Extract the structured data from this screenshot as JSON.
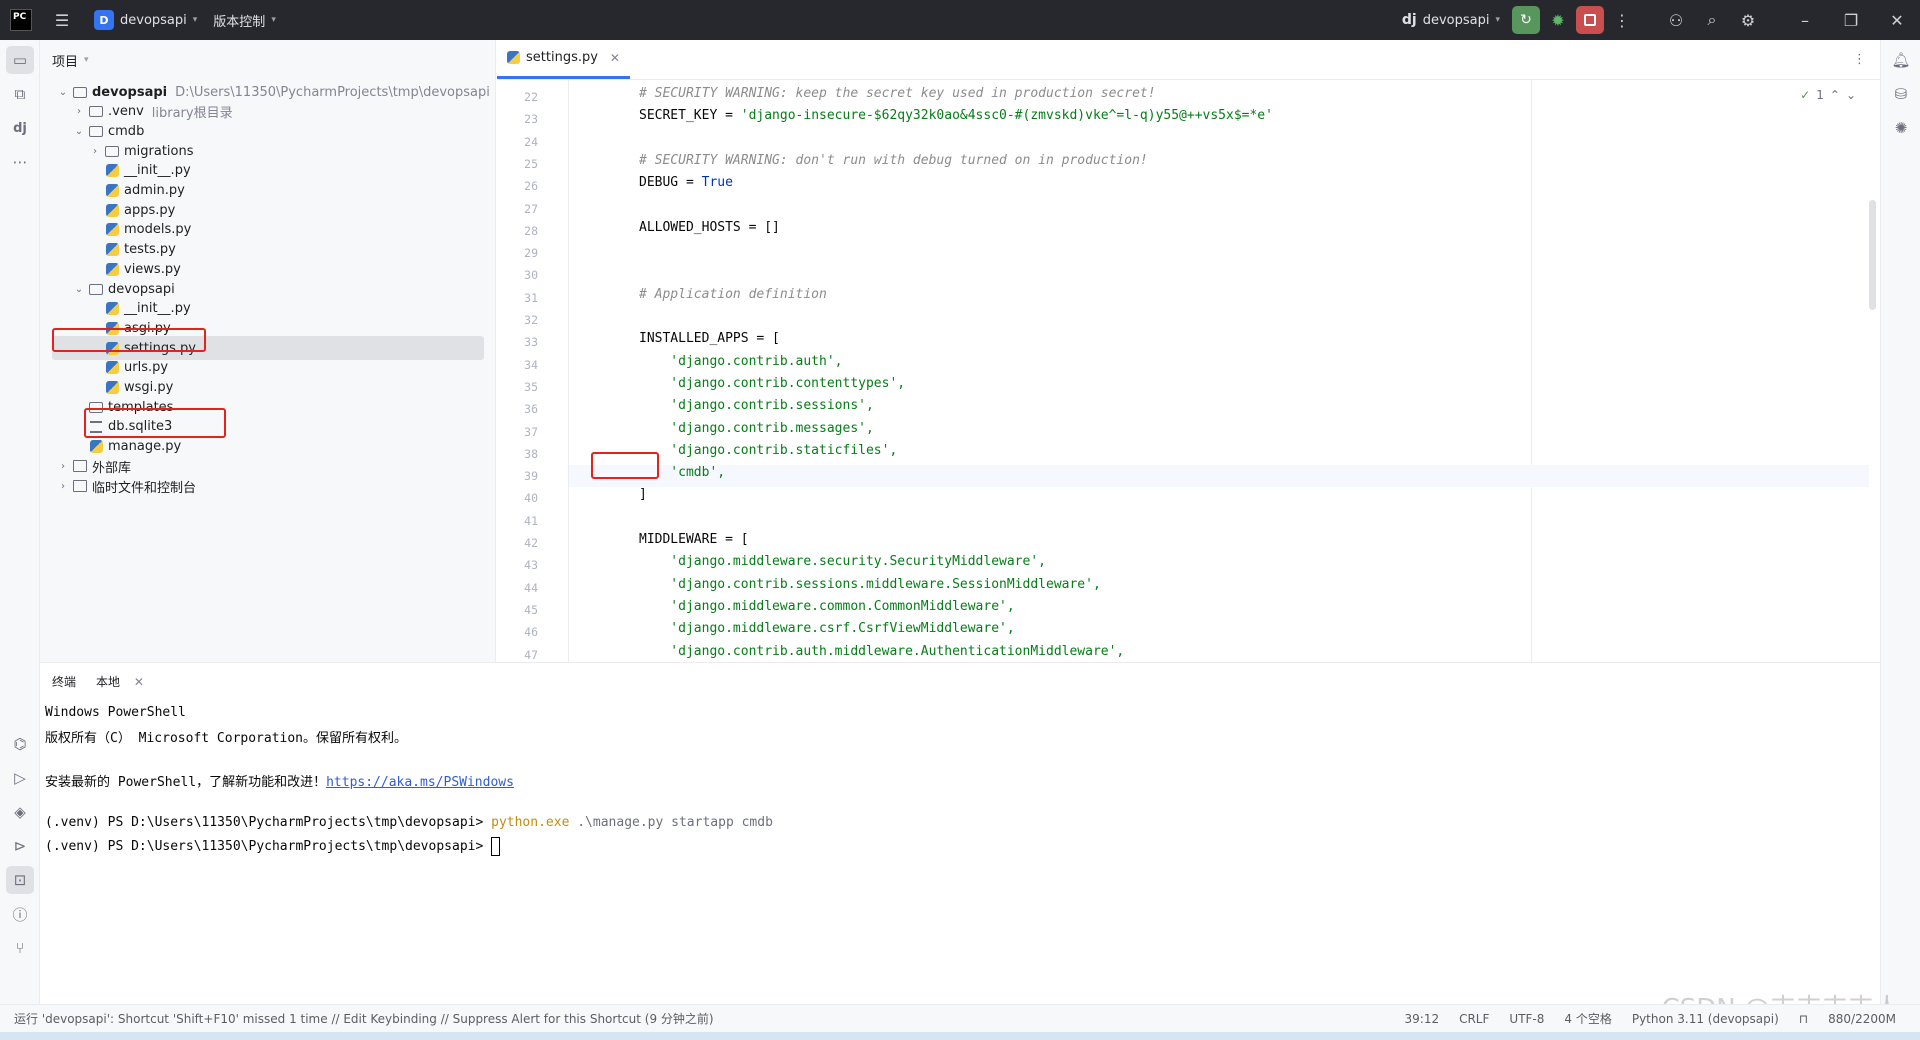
{
  "titlebar": {
    "app_logo": "PC",
    "project_badge": "D",
    "project_name": "devopsapi",
    "vcs_label": "版本控制",
    "run_config": "devopsapi",
    "icons": [
      "hamburger-icon",
      "run-icon",
      "debug-icon",
      "stop-icon",
      "more-icon",
      "add-user-icon",
      "search-icon",
      "gear-icon",
      "minimize-icon",
      "restore-icon",
      "close-icon"
    ]
  },
  "project_panel": {
    "title": "项目",
    "tree": [
      {
        "label": "devopsapi",
        "hint": "D:\\Users\\11350\\PycharmProjects\\tmp\\devopsapi",
        "type": "folder",
        "arrow": "⌄",
        "bold": true
      },
      {
        "label": ".venv",
        "hint": "library根目录",
        "type": "folder",
        "arrow": "›"
      },
      {
        "label": "cmdb",
        "hint": "",
        "type": "folder",
        "arrow": "⌄"
      },
      {
        "label": "migrations",
        "hint": "",
        "type": "folder",
        "arrow": "›"
      },
      {
        "label": "__init__.py",
        "hint": "",
        "type": "py",
        "arrow": ""
      },
      {
        "label": "admin.py",
        "hint": "",
        "type": "py",
        "arrow": ""
      },
      {
        "label": "apps.py",
        "hint": "",
        "type": "py",
        "arrow": ""
      },
      {
        "label": "models.py",
        "hint": "",
        "type": "py",
        "arrow": ""
      },
      {
        "label": "tests.py",
        "hint": "",
        "type": "py",
        "arrow": ""
      },
      {
        "label": "views.py",
        "hint": "",
        "type": "py",
        "arrow": ""
      },
      {
        "label": "devopsapi",
        "hint": "",
        "type": "folder",
        "arrow": "⌄"
      },
      {
        "label": "__init__.py",
        "hint": "",
        "type": "py",
        "arrow": ""
      },
      {
        "label": "asgi.py",
        "hint": "",
        "type": "py",
        "arrow": ""
      },
      {
        "label": "settings.py",
        "hint": "",
        "type": "py",
        "arrow": ""
      },
      {
        "label": "urls.py",
        "hint": "",
        "type": "py",
        "arrow": ""
      },
      {
        "label": "wsgi.py",
        "hint": "",
        "type": "py",
        "arrow": ""
      },
      {
        "label": "templates",
        "hint": "",
        "type": "folder",
        "arrow": ""
      },
      {
        "label": "db.sqlite3",
        "hint": "",
        "type": "db",
        "arrow": ""
      },
      {
        "label": "manage.py",
        "hint": "",
        "type": "py",
        "arrow": ""
      },
      {
        "label": "外部库",
        "hint": "",
        "type": "lib",
        "arrow": "›"
      },
      {
        "label": "临时文件和控制台",
        "hint": "",
        "type": "lib",
        "arrow": "›"
      }
    ]
  },
  "editor": {
    "tab_label": "settings.py",
    "inspection_count": "1",
    "lines": [
      {
        "n": "22",
        "t": "# SECURITY WARNING: keep the secret key used in production secret!",
        "k": "cm"
      },
      {
        "n": "23",
        "t": "SECRET_KEY = 'django-insecure-$62qy32k0ao&4ssc0-#(zmvskd)vke^=l-q)y55@++vs5x$=*e'",
        "k": "secret"
      },
      {
        "n": "24",
        "t": "",
        "k": ""
      },
      {
        "n": "25",
        "t": "# SECURITY WARNING: don't run with debug turned on in production!",
        "k": "cm"
      },
      {
        "n": "26",
        "t": "DEBUG = True",
        "k": "debug"
      },
      {
        "n": "27",
        "t": "",
        "k": ""
      },
      {
        "n": "28",
        "t": "ALLOWED_HOSTS = []",
        "k": ""
      },
      {
        "n": "29",
        "t": "",
        "k": ""
      },
      {
        "n": "30",
        "t": "",
        "k": ""
      },
      {
        "n": "31",
        "t": "# Application definition",
        "k": "cm"
      },
      {
        "n": "32",
        "t": "",
        "k": ""
      },
      {
        "n": "33",
        "t": "INSTALLED_APPS = [",
        "k": ""
      },
      {
        "n": "34",
        "t": "    'django.contrib.auth',",
        "k": "st"
      },
      {
        "n": "35",
        "t": "    'django.contrib.contenttypes',",
        "k": "st"
      },
      {
        "n": "36",
        "t": "    'django.contrib.sessions',",
        "k": "st"
      },
      {
        "n": "37",
        "t": "    'django.contrib.messages',",
        "k": "st"
      },
      {
        "n": "38",
        "t": "    'django.contrib.staticfiles',",
        "k": "st"
      },
      {
        "n": "39",
        "t": "    'cmdb',",
        "k": "st"
      },
      {
        "n": "40",
        "t": "]",
        "k": ""
      },
      {
        "n": "41",
        "t": "",
        "k": ""
      },
      {
        "n": "42",
        "t": "MIDDLEWARE = [",
        "k": ""
      },
      {
        "n": "43",
        "t": "    'django.middleware.security.SecurityMiddleware',",
        "k": "st"
      },
      {
        "n": "44",
        "t": "    'django.contrib.sessions.middleware.SessionMiddleware',",
        "k": "st"
      },
      {
        "n": "45",
        "t": "    'django.middleware.common.CommonMiddleware',",
        "k": "st"
      },
      {
        "n": "46",
        "t": "    'django.middleware.csrf.CsrfViewMiddleware',",
        "k": "st"
      },
      {
        "n": "47",
        "t": "    'django.contrib.auth.middleware.AuthenticationMiddleware',",
        "k": "st"
      }
    ]
  },
  "terminal": {
    "tab_terminal": "终端",
    "tab_local": "本地",
    "line1": "Windows PowerShell",
    "line2": "版权所有（C） Microsoft Corporation。保留所有权利。",
    "line4_text": "安装最新的 PowerShell，了解新功能和改进！",
    "line4_link": "https://aka.ms/PSWindows",
    "prompt": "(.venv) PS D:\\Users\\11350\\PycharmProjects\\tmp\\devopsapi> ",
    "cmd_exe": "python.exe",
    "cmd_args": " .\\manage.py startapp cmdb"
  },
  "statusbar": {
    "message": "运行 'devopsapi': Shortcut 'Shift+F10' missed 1 time // Edit Keybinding // Suppress Alert for this Shortcut (9 分钟之前)",
    "position": "39:12",
    "line_sep": "CRLF",
    "encoding": "UTF-8",
    "indent": "4 个空格",
    "interpreter": "Python 3.11 (devopsapi)",
    "memory": "880/2200M"
  },
  "watermark": "CSDN @丰丰丰丰人"
}
